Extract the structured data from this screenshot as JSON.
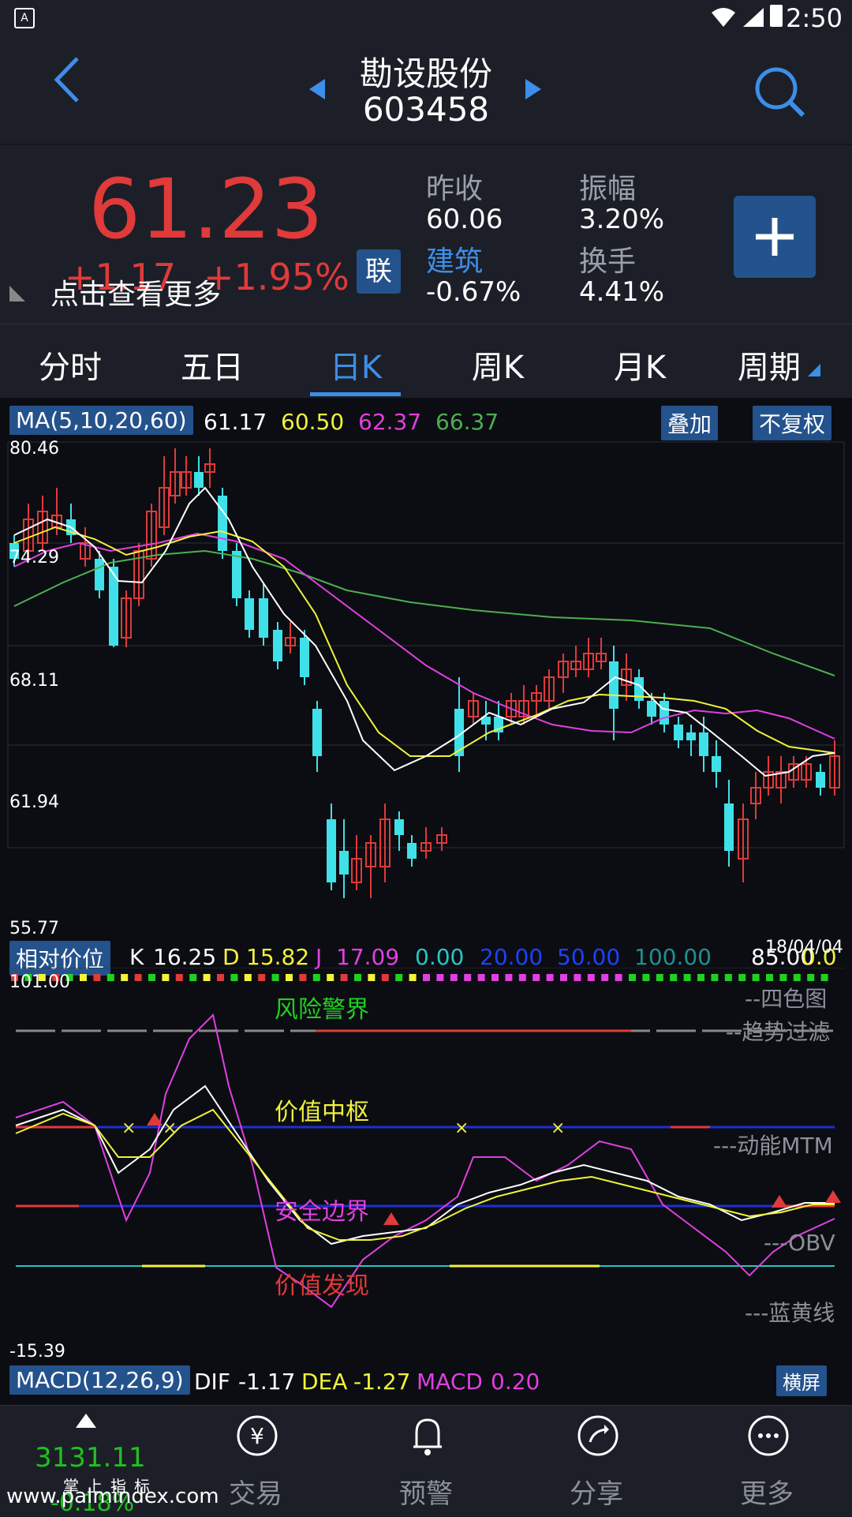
{
  "status_bar": {
    "time": "2:50"
  },
  "header": {
    "stock_name": "勘设股份",
    "stock_code": "603458"
  },
  "quote": {
    "price": "61.23",
    "change": "+1.17",
    "change_pct": "+1.95%",
    "see_more": "点击查看更多",
    "link_badge": "联",
    "prev_close_label": "昨收",
    "prev_close": "60.06",
    "sector_label": "建筑",
    "sector_change": "-0.67%",
    "amplitude_label": "振幅",
    "amplitude": "3.20%",
    "turnover_label": "换手",
    "turnover": "4.41%"
  },
  "tabs": [
    {
      "label": "分时"
    },
    {
      "label": "五日"
    },
    {
      "label": "日K"
    },
    {
      "label": "周K"
    },
    {
      "label": "月K"
    },
    {
      "label": "周期"
    }
  ],
  "main_chart": {
    "indicator": "MA(5,10,20,60)",
    "ma5": "61.17",
    "ma10": "60.50",
    "ma20": "62.37",
    "ma60": "66.37",
    "overlay_button": "叠加",
    "adjust_button": "不复权",
    "y_labels": [
      "80.46",
      "74.29",
      "68.11",
      "61.94",
      "55.77"
    ],
    "colors": {
      "up": "#e03a3a",
      "down": "#40e0e8",
      "ma5": "#ffffff",
      "ma10": "#f2f23a",
      "ma20": "#e040e0",
      "ma60": "#4caf50"
    }
  },
  "sub_chart": {
    "indicator": "相对价位",
    "k_label": "K",
    "k_value": "16.25",
    "d_label": "D",
    "d_value": "15.82",
    "j_label": "J",
    "j_value": "17.09",
    "v1": "0.00",
    "v2": "20.00",
    "v3": "50.00",
    "v4": "100.00",
    "v5": "85.00",
    "v6": "0.0",
    "date": "18/04/04",
    "top_value": "101.00",
    "bottom_value": "-15.39",
    "zone_risk": "风险警界",
    "zone_center": "价值中枢",
    "zone_safe": "安全边界",
    "zone_discover": "价值发现",
    "right_labels": [
      "--四色图",
      "--趋势过滤",
      "---动能MTM",
      "---OBV",
      "---蓝黄线"
    ]
  },
  "macd_bar": {
    "indicator": "MACD(12,26,9)",
    "dif_label": "DIF",
    "dif": "-1.17",
    "dea_label": "DEA",
    "dea": "-1.27",
    "macd_label": "MACD",
    "macd": "0.20",
    "landscape_button": "横屏"
  },
  "bottom_nav": {
    "index_value": "3131.11",
    "index_change": "-0.18%",
    "index_label": "掌上指标",
    "watermark": "www.palmindex.com",
    "items": [
      {
        "label": "交易"
      },
      {
        "label": "预警"
      },
      {
        "label": "分享"
      },
      {
        "label": "更多"
      }
    ]
  }
}
